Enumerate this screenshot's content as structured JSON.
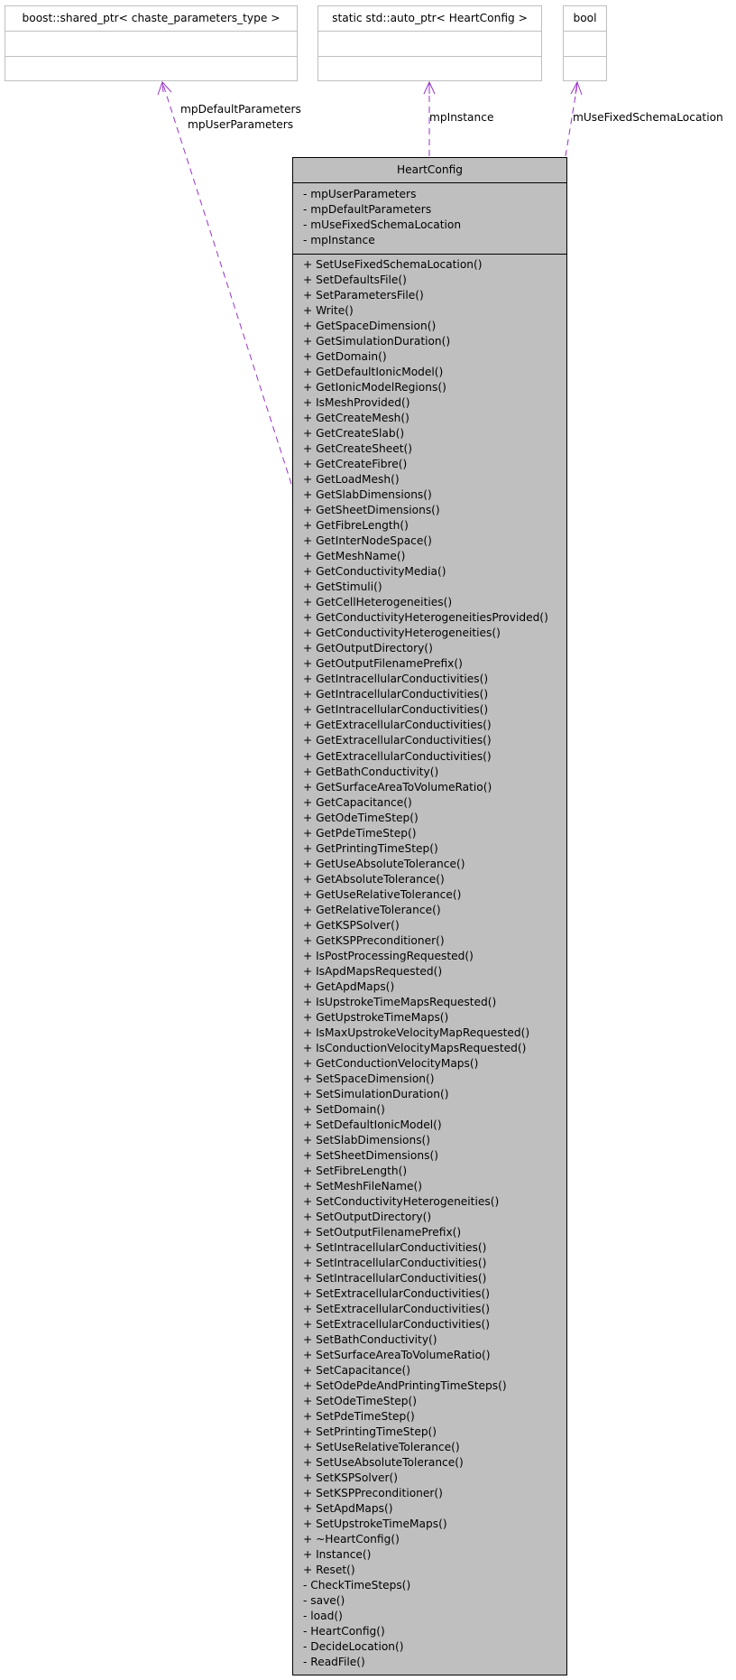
{
  "external_types": [
    {
      "name": "boost::shared_ptr< chaste_parameters_type >"
    },
    {
      "name": "static std::auto_ptr< HeartConfig >"
    },
    {
      "name": "bool"
    }
  ],
  "edge_labels": {
    "shared_ptr": [
      "mpDefaultParameters",
      "mpUserParameters"
    ],
    "auto_ptr": "mpInstance",
    "bool": "mUseFixedSchemaLocation"
  },
  "edge_color": "#9a32cd",
  "main_class": {
    "name": "HeartConfig",
    "attributes": [
      "- mpUserParameters",
      "- mpDefaultParameters",
      "- mUseFixedSchemaLocation",
      "- mpInstance"
    ],
    "methods": [
      "+ SetUseFixedSchemaLocation()",
      "+ SetDefaultsFile()",
      "+ SetParametersFile()",
      "+ Write()",
      "+ GetSpaceDimension()",
      "+ GetSimulationDuration()",
      "+ GetDomain()",
      "+ GetDefaultIonicModel()",
      "+ GetIonicModelRegions()",
      "+ IsMeshProvided()",
      "+ GetCreateMesh()",
      "+ GetCreateSlab()",
      "+ GetCreateSheet()",
      "+ GetCreateFibre()",
      "+ GetLoadMesh()",
      "+ GetSlabDimensions()",
      "+ GetSheetDimensions()",
      "+ GetFibreLength()",
      "+ GetInterNodeSpace()",
      "+ GetMeshName()",
      "+ GetConductivityMedia()",
      "+ GetStimuli()",
      "+ GetCellHeterogeneities()",
      "+ GetConductivityHeterogeneitiesProvided()",
      "+ GetConductivityHeterogeneities()",
      "+ GetOutputDirectory()",
      "+ GetOutputFilenamePrefix()",
      "+ GetIntracellularConductivities()",
      "+ GetIntracellularConductivities()",
      "+ GetIntracellularConductivities()",
      "+ GetExtracellularConductivities()",
      "+ GetExtracellularConductivities()",
      "+ GetExtracellularConductivities()",
      "+ GetBathConductivity()",
      "+ GetSurfaceAreaToVolumeRatio()",
      "+ GetCapacitance()",
      "+ GetOdeTimeStep()",
      "+ GetPdeTimeStep()",
      "+ GetPrintingTimeStep()",
      "+ GetUseAbsoluteTolerance()",
      "+ GetAbsoluteTolerance()",
      "+ GetUseRelativeTolerance()",
      "+ GetRelativeTolerance()",
      "+ GetKSPSolver()",
      "+ GetKSPPreconditioner()",
      "+ IsPostProcessingRequested()",
      "+ IsApdMapsRequested()",
      "+ GetApdMaps()",
      "+ IsUpstrokeTimeMapsRequested()",
      "+ GetUpstrokeTimeMaps()",
      "+ IsMaxUpstrokeVelocityMapRequested()",
      "+ IsConductionVelocityMapsRequested()",
      "+ GetConductionVelocityMaps()",
      "+ SetSpaceDimension()",
      "+ SetSimulationDuration()",
      "+ SetDomain()",
      "+ SetDefaultIonicModel()",
      "+ SetSlabDimensions()",
      "+ SetSheetDimensions()",
      "+ SetFibreLength()",
      "+ SetMeshFileName()",
      "+ SetConductivityHeterogeneities()",
      "+ SetOutputDirectory()",
      "+ SetOutputFilenamePrefix()",
      "+ SetIntracellularConductivities()",
      "+ SetIntracellularConductivities()",
      "+ SetIntracellularConductivities()",
      "+ SetExtracellularConductivities()",
      "+ SetExtracellularConductivities()",
      "+ SetExtracellularConductivities()",
      "+ SetBathConductivity()",
      "+ SetSurfaceAreaToVolumeRatio()",
      "+ SetCapacitance()",
      "+ SetOdePdeAndPrintingTimeSteps()",
      "+ SetOdeTimeStep()",
      "+ SetPdeTimeStep()",
      "+ SetPrintingTimeStep()",
      "+ SetUseRelativeTolerance()",
      "+ SetUseAbsoluteTolerance()",
      "+ SetKSPSolver()",
      "+ SetKSPPreconditioner()",
      "+ SetApdMaps()",
      "+ SetUpstrokeTimeMaps()",
      "+ ~HeartConfig()",
      "+ Instance()",
      "+ Reset()",
      "- CheckTimeSteps()",
      "- save()",
      "- load()",
      "- HeartConfig()",
      "- DecideLocation()",
      "- ReadFile()"
    ]
  }
}
